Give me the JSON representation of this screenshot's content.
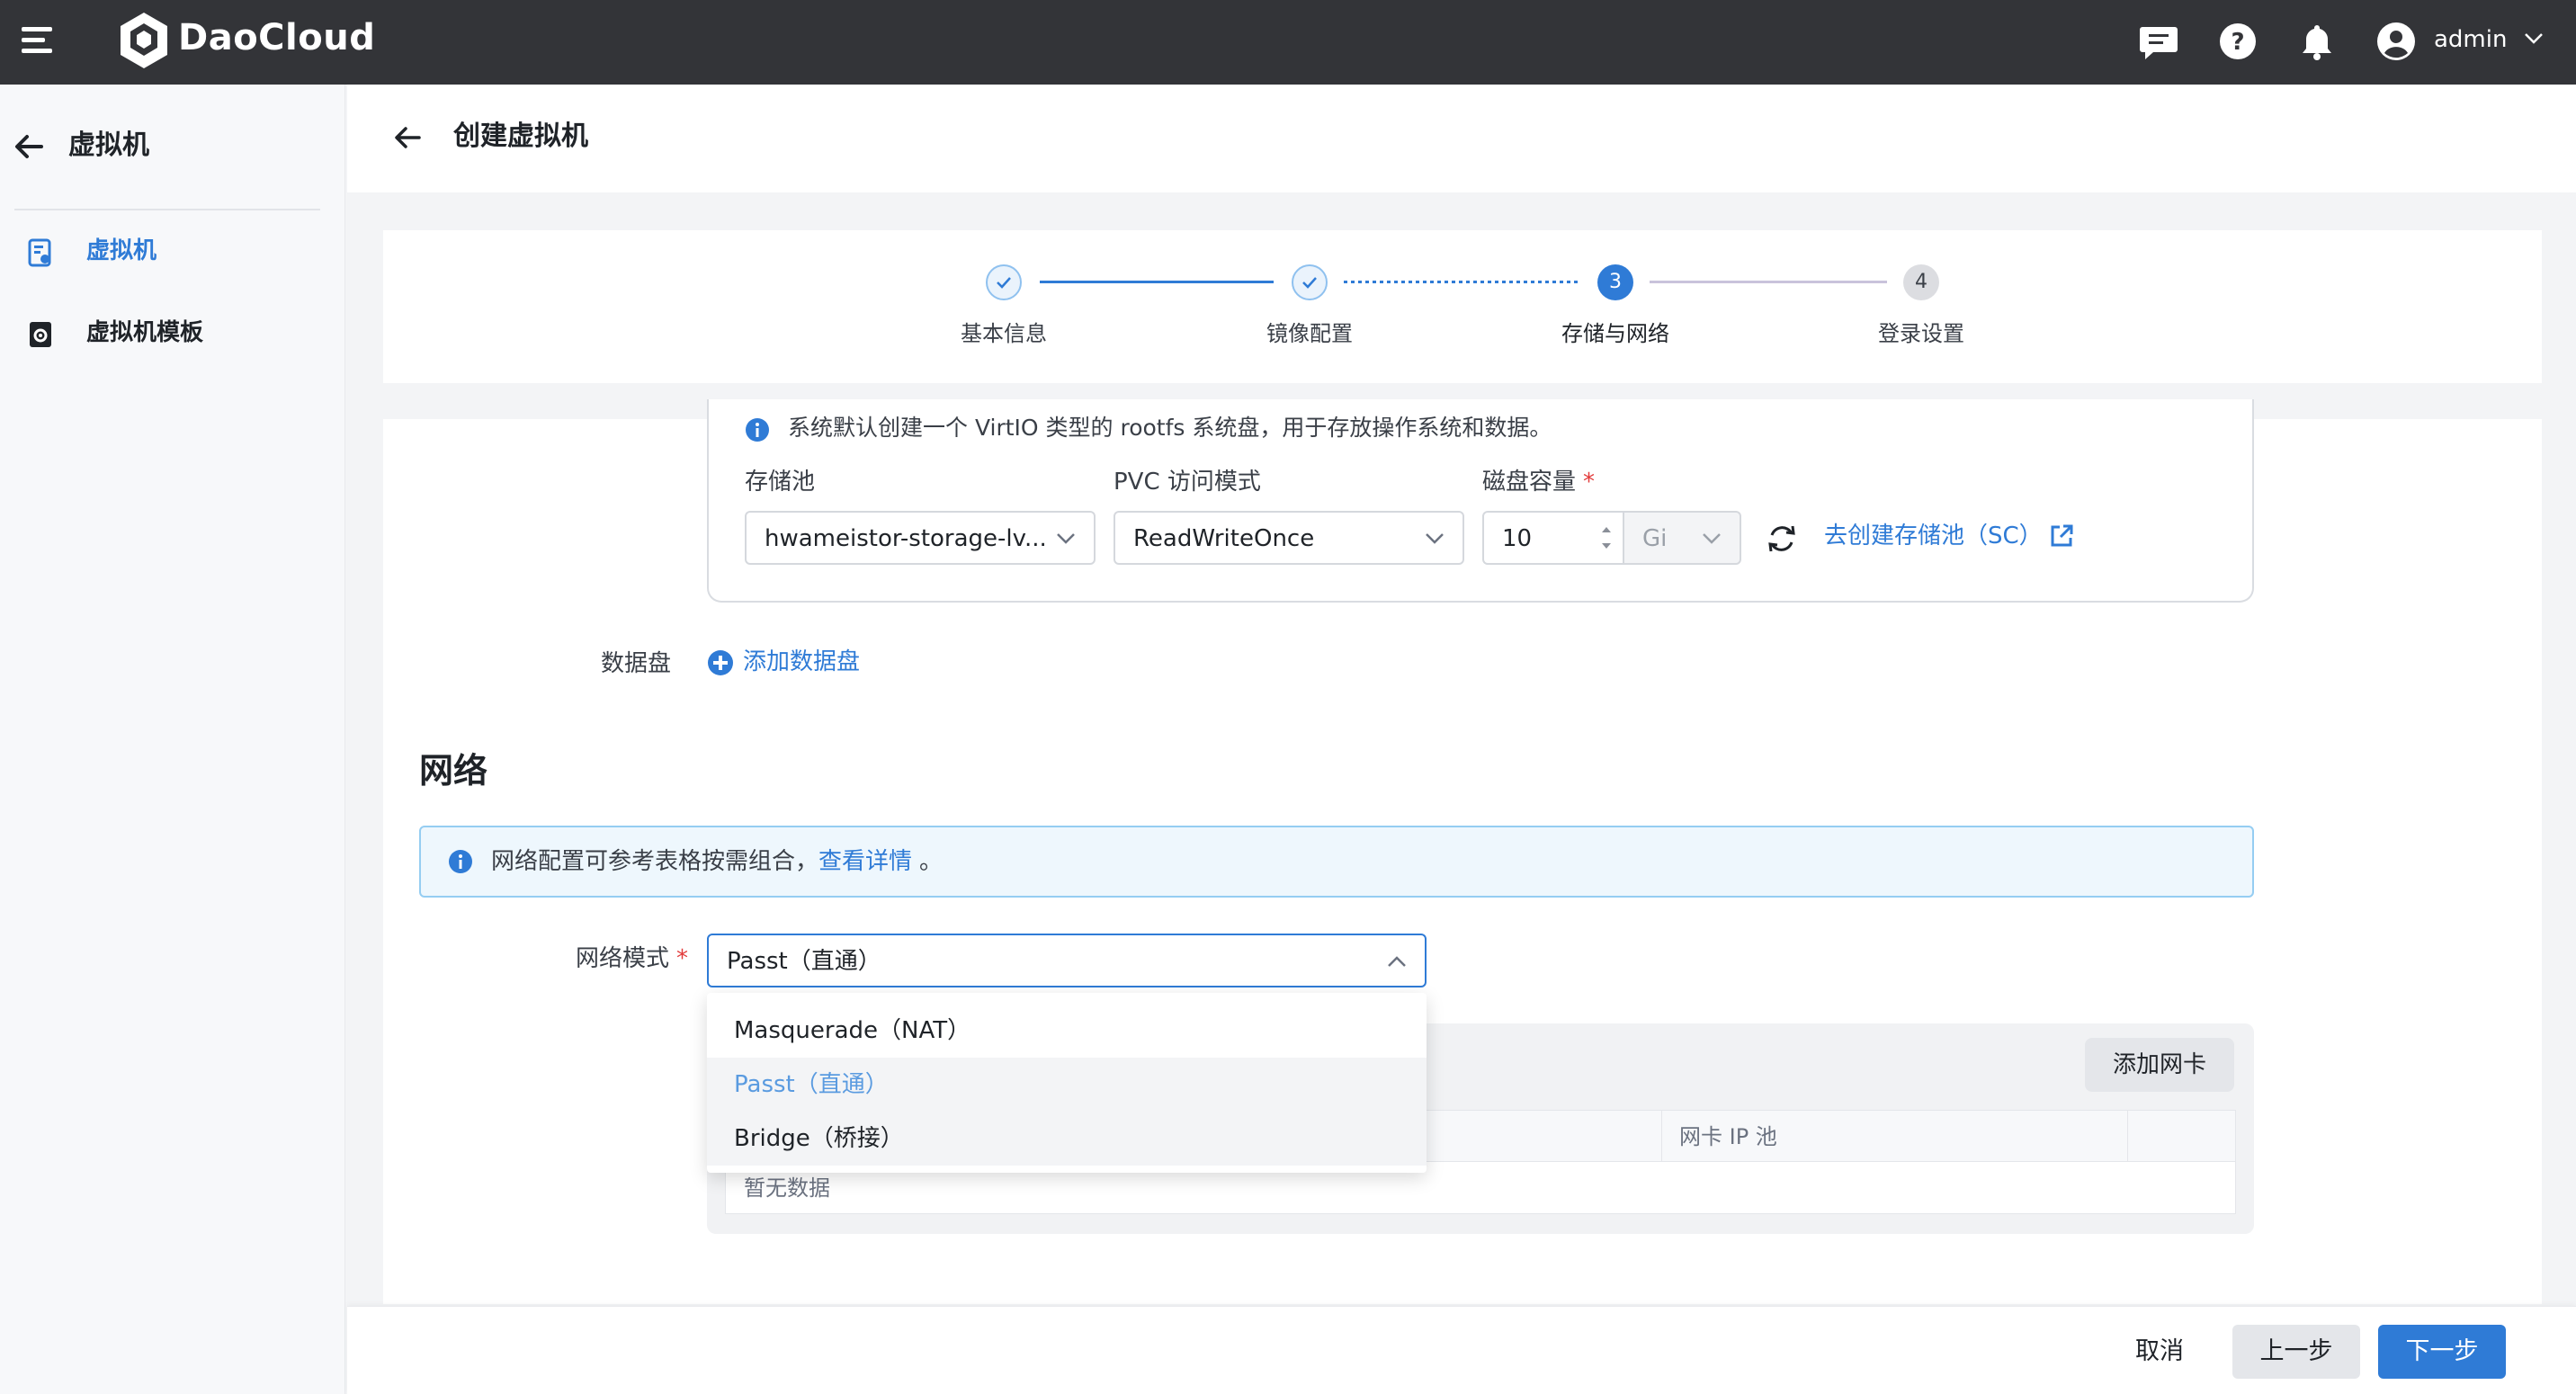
{
  "app": {
    "brand": "DaoCloud",
    "username": "admin"
  },
  "sidebar": {
    "title": "虚拟机",
    "items": [
      {
        "label": "虚拟机",
        "icon": "vm-list-icon",
        "active": true
      },
      {
        "label": "虚拟机模板",
        "icon": "vm-template-icon",
        "active": false
      }
    ]
  },
  "page": {
    "title": "创建虚拟机"
  },
  "steps": [
    {
      "index": "1",
      "label": "基本信息",
      "status": "done"
    },
    {
      "index": "2",
      "label": "镜像配置",
      "status": "done"
    },
    {
      "index": "3",
      "label": "存储与网络",
      "status": "active"
    },
    {
      "index": "4",
      "label": "登录设置",
      "status": "pending"
    }
  ],
  "storage": {
    "info": "系统默认创建一个 VirtIO 类型的 rootfs 系统盘，用于存放操作系统和数据。",
    "pool_label": "存储池",
    "pool_value": "hwameistor-storage-lv...",
    "pvc_label": "PVC 访问模式",
    "pvc_value": "ReadWriteOnce",
    "capacity_label": "磁盘容量",
    "capacity_value": "10",
    "capacity_unit": "Gi",
    "create_sc_link": "去创建存储池（SC）",
    "data_disk_label": "数据盘",
    "add_data_disk": "添加数据盘"
  },
  "network": {
    "section_title": "网络",
    "alert_text": "网络配置可参考表格按需组合，",
    "alert_link": "查看详情",
    "alert_suffix": "。",
    "mode_label": "网络模式",
    "mode_value": "Passt（直通）",
    "options": [
      "Masquerade（NAT）",
      "Passt（直通）",
      "Bridge（桥接）"
    ],
    "add_nic": "添加网卡",
    "table_col_ippool": "网卡 IP 池",
    "empty_text": "暂无数据"
  },
  "footer": {
    "cancel": "取消",
    "prev": "上一步",
    "next": "下一步"
  },
  "colors": {
    "primary": "#2f7bd6",
    "topbar": "#333438",
    "danger": "#e23b3b"
  }
}
